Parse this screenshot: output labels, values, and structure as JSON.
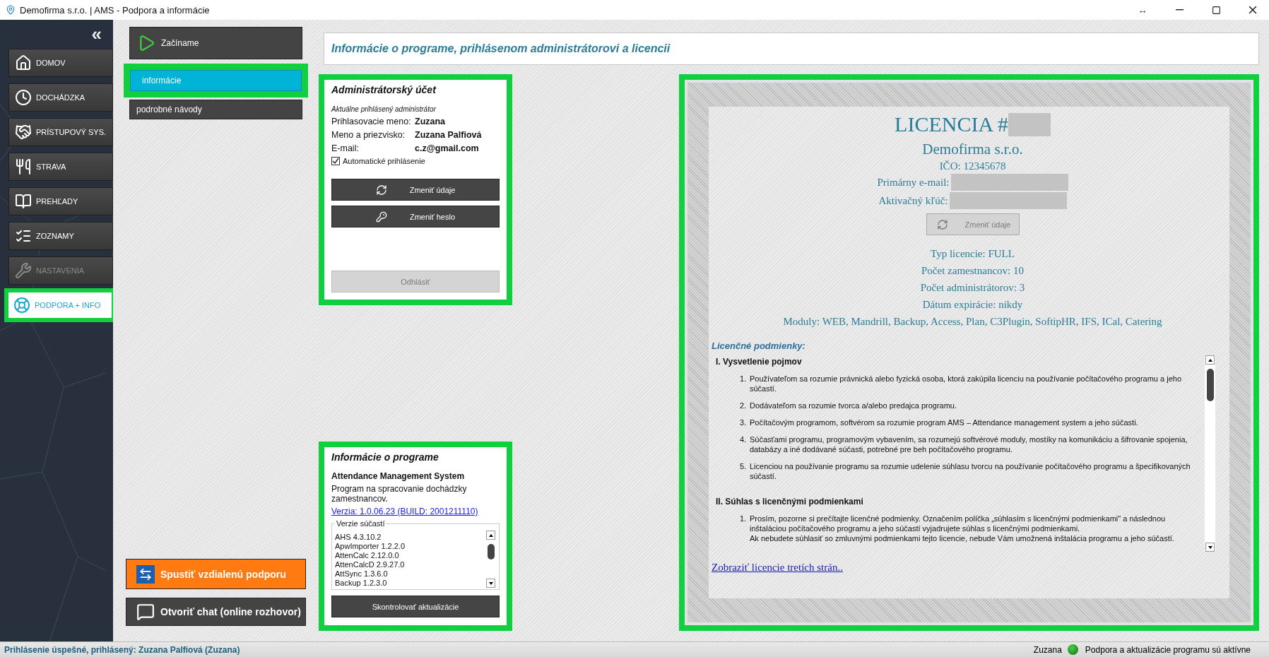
{
  "window": {
    "title": "Demofirma s.r.o. | AMS - Podpora a informácie",
    "resize_glyph": "↔"
  },
  "sidebar": {
    "collapse_glyph": "«",
    "items": [
      {
        "label": "DOMOV",
        "selected": false,
        "disabled": false
      },
      {
        "label": "DOCHÁDZKA",
        "selected": false,
        "disabled": false
      },
      {
        "label": "PRÍSTUPOVÝ SYS.",
        "selected": false,
        "disabled": false
      },
      {
        "label": "STRAVA",
        "selected": false,
        "disabled": false
      },
      {
        "label": "PREHĽADY",
        "selected": false,
        "disabled": false
      },
      {
        "label": "ZOZNAMY",
        "selected": false,
        "disabled": false
      },
      {
        "label": "NASTAVENIA",
        "selected": false,
        "disabled": true
      },
      {
        "label": "PODPORA + INFO",
        "selected": true,
        "disabled": false
      }
    ]
  },
  "subnav": {
    "start_button": "Začíname",
    "items": [
      {
        "label": "informácie",
        "selected": true
      },
      {
        "label": "podrobné návody",
        "selected": false
      }
    ],
    "support_buttons": [
      {
        "label": "Spustiť vzdialenú podporu",
        "kind": "remote"
      },
      {
        "label": "Otvoriť chat (online rozhovor)",
        "kind": "chat"
      }
    ]
  },
  "header": {
    "title": "Informácie o programe, prihlásenom administrátorovi a licencii"
  },
  "admin_account": {
    "title": "Administrátorský účet",
    "subtitle": "Aktuálne prihlásený administrátor",
    "fields": [
      {
        "label": "Prihlasovacie meno:",
        "value": "Zuzana"
      },
      {
        "label": "Meno a priezvisko:",
        "value": "Zuzana Palfiová"
      },
      {
        "label": "E-mail:",
        "value": "c.z@gmail.com"
      }
    ],
    "auto_login": {
      "label": "Automatické prihlásenie",
      "checked": true
    },
    "buttons": [
      {
        "label": "Zmeniť údaje",
        "kind": "refresh"
      },
      {
        "label": "Zmeniť heslo",
        "kind": "keys"
      }
    ],
    "logout": {
      "label": "Odhlásiť",
      "disabled": true
    }
  },
  "program_info": {
    "title": "Informácie o programe",
    "name": "Attendance Management System",
    "description": "Program na spracovanie dochádzky zamestnancov.",
    "version_link": "Verzia: 1.0.06.23 (BUILD: 2001211110)",
    "components_legend": "Verzie súčastí",
    "components": [
      "AHS 4.3.10.2",
      "ApwImporter 1.2.2.0",
      "AttenCalc 2.12.0.0",
      "AttenCalcD 2.9.27.0",
      "AttSync 1.3.6.0",
      "Backup 1.2.3.0"
    ],
    "check_button": "Skontrolovať aktualizácie"
  },
  "license": {
    "title": "LICENCIA #",
    "company": "Demofirma s.r.o.",
    "ico": "IČO: 12345678",
    "hidden_fields": [
      "Primárny e-mail:",
      "Aktivačný kľúč:"
    ],
    "change_button": {
      "label": "Zmeniť údaje",
      "disabled": true
    },
    "details": [
      "Typ licencie: FULL",
      "Počet zamestnancov: 10",
      "Počet administrátorov: 3",
      "Dátum expirácie: nikdy",
      "Moduly: WEB, Mandrill, Backup, Access, Plan, C3Plugin, SoftipHR, IFS, ICal, Catering"
    ],
    "terms_title": "Licenčné podmienky:",
    "terms": [
      {
        "heading": "I. Vysvetlenie pojmov",
        "items": [
          {
            "number": "1.",
            "text": "Používateľom sa rozumie právnická alebo fyzická osoba, ktorá zakúpila licenciu na používanie počítačového programu a jeho súčastí."
          },
          {
            "number": "2.",
            "text": "Dodávateľom sa rozumie tvorca a/alebo predajca programu."
          },
          {
            "number": "3.",
            "text": "Počítačovým programom, softvérom sa rozumie program AMS – Attendance management system a jeho súčasti."
          },
          {
            "number": "4.",
            "text": "Súčasťami programu, programovým vybavením, sa rozumejú softvérové moduly, mostíky na komunikáciu a šifrovanie spojenia, databázy a iné dodávané súčasti, potrebné pre beh počítačového programu."
          },
          {
            "number": "5.",
            "text": "Licenciou na používanie programu sa rozumie udelenie súhlasu tvorcu na používanie počítačového programu a špecifikovaných súčastí."
          }
        ]
      },
      {
        "heading": "II. Súhlas s licenčnými podmienkami",
        "items": [
          {
            "number": "1.",
            "text": "Prosím, pozorne si prečítajte licenčné podmienky. Označením políčka „súhlasím s licenčnými podmienkami\" a následnou inštaláciou počítačového programu a jeho súčastí vyjadrujete súhlas s licenčnými podmienkami.\nAk nebudete súhlasiť so zmluvnými podmienkami tejto licencie, nebude Vám umožnená inštalácia programu a jeho súčastí."
          }
        ]
      }
    ],
    "third_party_link": "Zobraziť licencie tretích strán.."
  },
  "status_bar": {
    "message": "Prihlásenie úspešné, prihlásený: Zuzana Palfiová (Zuzana)",
    "user": "Zuzana",
    "status_text": "Podpora a aktualizácie programu sú aktívne"
  }
}
